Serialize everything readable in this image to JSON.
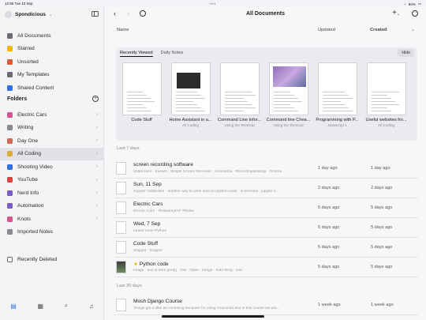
{
  "status": {
    "time": "12:55",
    "date": "Tue 13 Sep",
    "battery": "84%"
  },
  "sidebar": {
    "account": "Spondicious",
    "nav": [
      {
        "label": "All Documents",
        "icon": "documents-icon",
        "color": "#6b6b70"
      },
      {
        "label": "Starred",
        "icon": "star-icon",
        "color": "#f2b705"
      },
      {
        "label": "Unsorted",
        "icon": "tray-icon",
        "color": "#e05a3a"
      },
      {
        "label": "My Templates",
        "icon": "template-icon",
        "color": "#6b6b70"
      },
      {
        "label": "Shared Content",
        "icon": "share-icon",
        "color": "#2f6fe4"
      }
    ],
    "folders_title": "Folders",
    "folders": [
      {
        "label": "Electric Cars",
        "icon": "car-icon",
        "color": "#d9548f"
      },
      {
        "label": "Writing",
        "icon": "pen-icon",
        "color": "#8a8a8f"
      },
      {
        "label": "Day One",
        "icon": "folder-icon",
        "color": "#d06b50"
      },
      {
        "label": "All Coding",
        "icon": "key-icon",
        "color": "#e0a93a"
      },
      {
        "label": "Shooting Video",
        "icon": "camera-icon",
        "color": "#2f6fe4"
      },
      {
        "label": "YouTube",
        "icon": "video-icon",
        "color": "#d9433a"
      },
      {
        "label": "Nerd Info",
        "icon": "atom-icon",
        "color": "#7a5bc7"
      },
      {
        "label": "Automation",
        "icon": "gear-icon",
        "color": "#7a5bc7"
      },
      {
        "label": "Knots",
        "icon": "knot-icon",
        "color": "#d9548f"
      },
      {
        "label": "Imported Notes",
        "icon": "note-icon",
        "color": "#8a8a8f"
      }
    ],
    "recently_deleted": "Recently Deleted"
  },
  "main": {
    "title": "All Documents",
    "columns": {
      "name": "Name",
      "updated": "Updated",
      "created": "Created"
    },
    "recent": {
      "tabs": [
        "Recently Viewed",
        "Daily Notes"
      ],
      "hide": "Hide",
      "cards": [
        {
          "title": "Code Stuff",
          "sub": ""
        },
        {
          "title": "Home Assistant in a...",
          "sub": "All Coding"
        },
        {
          "title": "Command Line Infor...",
          "sub": "Using the Terminal"
        },
        {
          "title": "Command line Chea...",
          "sub": "Using the Terminal"
        },
        {
          "title": "Programming with P...",
          "sub": "Javascript 1"
        },
        {
          "title": "Useful websites fro...",
          "sub": "All Coding"
        }
      ]
    },
    "section1": "Last 7 days",
    "section2": "Last 30 days",
    "docs": [
      {
        "title": "screen recording software",
        "sub": "Volkscreen · Kazam · Simple Screen Recorder · Asciinema · Recordmydesktop · Gnome...",
        "updated": "1 day ago",
        "created": "1 day ago"
      },
      {
        "title": "Sun, 11 Sep",
        "sub": "Jupyter notebooks · another way to write and run python code · in terminal · jupyter n...",
        "updated": "2 days ago",
        "created": "2 days ago"
      },
      {
        "title": "Electric Cars",
        "sub": "Electric Cars · #NissanLEAF #Rosie",
        "updated": "5 days ago",
        "created": "5 days ago"
      },
      {
        "title": "Wed, 7 Sep",
        "sub": "Learnt more Python",
        "updated": "5 days ago",
        "created": "5 days ago"
      },
      {
        "title": "Code Stuff",
        "sub": "Snippet · Snippet",
        "updated": "5 days ago",
        "created": "5 days ago"
      },
      {
        "title": "Python code",
        "sub": "Image · text in here print() · File · Table · Image · todo thing · text",
        "updated": "5 days ago",
        "created": "5 days ago",
        "starred": true
      },
      {
        "title": "Mosh Django Course",
        "sub": "Things got a little bit confusing because I'm using Anaconda and in this course we are...",
        "updated": "1 week ago",
        "created": "1 week ago"
      }
    ]
  }
}
